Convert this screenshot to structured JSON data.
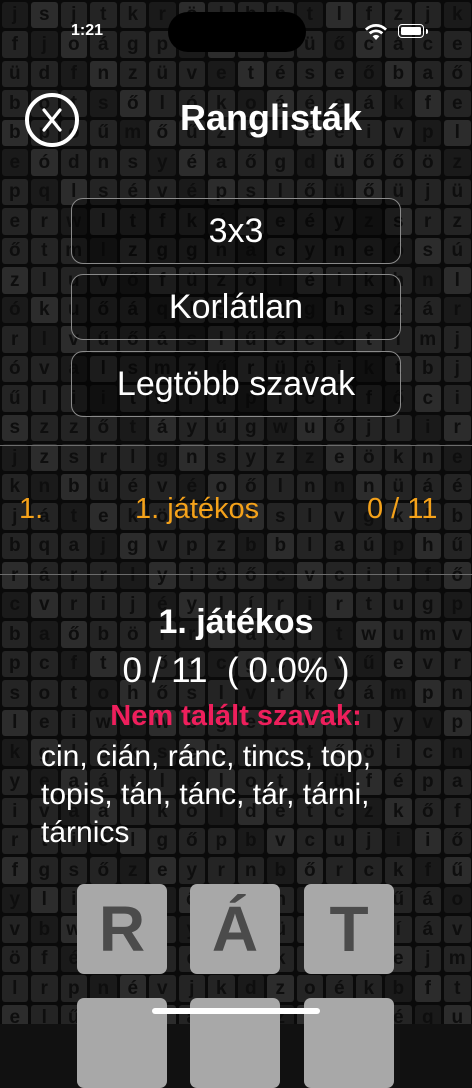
{
  "status_bar": {
    "time": "1:21"
  },
  "header": {
    "title": "Ranglisták",
    "close_icon": "x-circle-icon"
  },
  "options": [
    "3x3",
    "Korlátlan",
    "Legtöbb szavak"
  ],
  "ranking": [
    {
      "position": "1.",
      "name": "1. játékos",
      "score": "0 / 11"
    }
  ],
  "detail": {
    "player": "1. játékos",
    "score": "0 / 11  ( 0.0% )",
    "missed_label": "Nem talált szavak:",
    "missed_words": "cin, cián, ránc, tincs, top, topis, tán, tánc, tár, tárni, tárnics"
  },
  "board_letters": [
    "R",
    "Á",
    "T",
    "",
    "",
    ""
  ],
  "background_letters": "jsjtkrölbhtlfzjkfjoágpzűbsüőcáceüdfnzüvetéseőbaőbőtsőlókoáéeákfebpoűmőűzőfééivpleódnsyéaőgdüőőözpqlsévépslőüőüjüerwltfkéneéyzsrzőtmlzggnacyneósúzluvőfüzőiélkhnlókuőáqlgöüghszárrlvűőáslűőeótlmjóvalsmzűrüöiktbjűliitwrüplclfőciszzőtáyúgwuőjlirjzsrlgnsyzzeökneknbüévéoőlnnnüáéjátekössfslvgklbbqajgvpzbblaúphűrárrlyiöőcvcilfőcvrijéylírirtugpbaőbölriaxitwumvpcfttőscgcvvűevrsotohőslvrkoámpnleiwrwbgefhelyvpkglóksebqvtőöicnyeaátlelotlüfépaivaalkoldétczkőfrtiélgőpbvcujiiőfgsőzeyrnbőrckfűylicedőüáhtzzűáovbwpzlyoyükfcíávöfébmlévkknsóejmlrpnévjkdzoékbftelűléfaobzcwjéqubfgfjhhifaqérdöüíntvlzsitszőátmacitpőbüyfejuknnkárgjvőüőzőlíözcsltzetpőéűuéjbkfhjkgsagbthtívmfgpleroőrrtgmuncrlozvzcbvqgkfnigkjekrnjkanfbmyvuleüiwmcqhlőkyjjésr"
}
